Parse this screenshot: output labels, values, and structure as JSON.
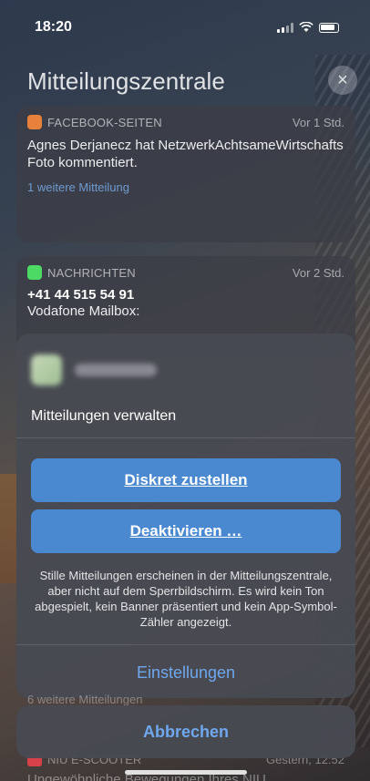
{
  "status_bar": {
    "time": "18:20"
  },
  "notification_center": {
    "title": "Mitteilungszentrale",
    "close_symbol": "×"
  },
  "notifications": [
    {
      "app": "FACEBOOK-SEITEN",
      "time": "Vor 1 Std.",
      "body": "Agnes Derjanecz hat NetzwerkAchtsameWirtschafts Foto kommentiert.",
      "more": "1 weitere Mitteilung",
      "icon_color": "#e8823b"
    },
    {
      "app": "NACHRICHTEN",
      "time": "Vor 2 Std.",
      "title": "+41 44 515 54 91",
      "body": "Vodafone Mailbox:",
      "icon_color": "#4cd964"
    }
  ],
  "manage_sheet": {
    "title": "Mitteilungen verwalten",
    "deliver_quietly": "Diskret zustellen",
    "turn_off": "Deaktivieren …",
    "description": "Stille Mitteilungen erscheinen in der Mitteilungszentrale, aber nicht auf dem Sperrbildschirm. Es wird kein Ton abgespielt, kein Banner präsentiert und kein App-Symbol-Zähler angezeigt.",
    "settings": "Einstellungen",
    "accent_color": "#4a88cf"
  },
  "behind_more": "6 weitere Mitteilungen",
  "cancel": "Abbrechen",
  "bottom_notification": {
    "app": "NIU E-SCOOTER",
    "time": "Gestern, 12:52",
    "body": "Ungewöhnliche Bewegungen Ihres NIU"
  }
}
